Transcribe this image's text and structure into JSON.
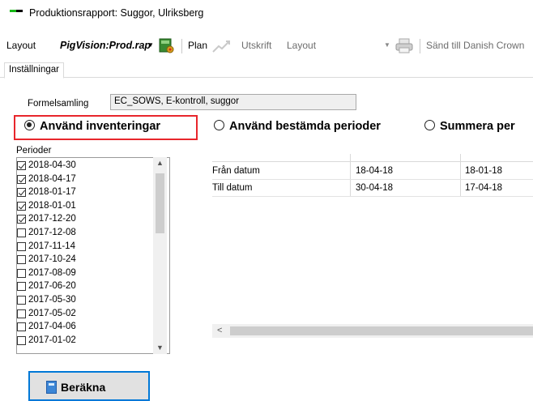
{
  "window": {
    "title": "Produktionsrapport: Suggor, Ulriksberg"
  },
  "toolbar": {
    "layout_label": "Layout",
    "layout_value": "PigVision:Prod.rap",
    "plan_label": "Plan",
    "print_label": "Utskrift",
    "print_layout_value": "Layout",
    "send_label": "Sänd till Danish Crown"
  },
  "tabs": [
    {
      "label": "Inställningar"
    }
  ],
  "settings": {
    "formel_label": "Formelsamling",
    "formel_value": "EC_SOWS, E-kontroll, suggor",
    "radio_inventory": "Använd inventeringar",
    "radio_fixed": "Använd bestämda perioder",
    "radio_sum": "Summera per",
    "perioder_label": "Perioder",
    "periods": [
      {
        "date": "2018-04-30",
        "checked": true
      },
      {
        "date": "2018-04-17",
        "checked": true
      },
      {
        "date": "2018-01-17",
        "checked": true
      },
      {
        "date": "2018-01-01",
        "checked": true
      },
      {
        "date": "2017-12-20",
        "checked": true
      },
      {
        "date": "2017-12-08",
        "checked": false
      },
      {
        "date": "2017-11-14",
        "checked": false
      },
      {
        "date": "2017-10-24",
        "checked": false
      },
      {
        "date": "2017-08-09",
        "checked": false
      },
      {
        "date": "2017-06-20",
        "checked": false
      },
      {
        "date": "2017-05-30",
        "checked": false
      },
      {
        "date": "2017-05-02",
        "checked": false
      },
      {
        "date": "2017-04-06",
        "checked": false
      },
      {
        "date": "2017-01-02",
        "checked": false
      }
    ],
    "calc_button": "Beräkna"
  },
  "grid": {
    "rows": [
      {
        "label": "Från datum",
        "c1": "18-04-18",
        "c2": "18-01-18"
      },
      {
        "label": "Till datum",
        "c1": "30-04-18",
        "c2": "17-04-18"
      }
    ]
  }
}
